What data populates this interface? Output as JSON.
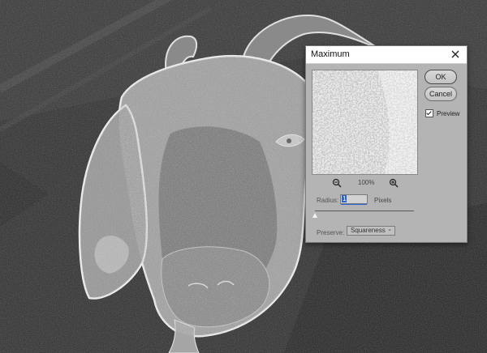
{
  "dialog": {
    "title": "Maximum",
    "ok_label": "OK",
    "cancel_label": "Cancel",
    "preview_label": "Preview",
    "preview_checked": true,
    "zoom_level": "100%",
    "radius_label": "Radius:",
    "radius_value": "1",
    "radius_unit": "Pixels",
    "radius_slider_fraction": 0.0,
    "preserve_label": "Preserve:",
    "preserve_value": "Squareness"
  },
  "icons": {
    "close": "close-icon",
    "zoom_out": "zoom-out-icon",
    "zoom_in": "zoom-in-icon",
    "dropdown": "chevron-down-icon"
  }
}
